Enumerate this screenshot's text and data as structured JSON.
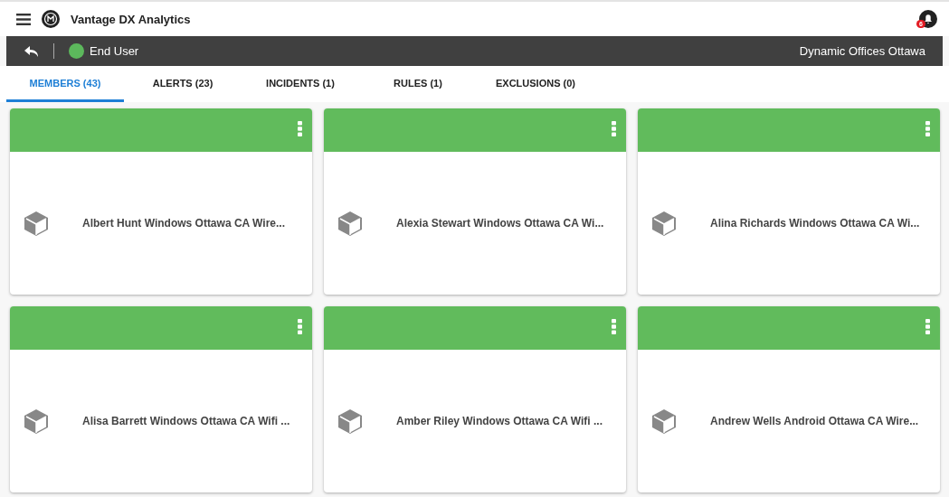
{
  "app": {
    "title": "Vantage DX Analytics",
    "notification_count": "6"
  },
  "context_bar": {
    "role": {
      "label": "End User",
      "color": "#5cb85c"
    },
    "location": "Dynamic Offices Ottawa"
  },
  "tabs": [
    {
      "label": "MEMBERS (43)",
      "selected": true
    },
    {
      "label": "ALERTS (23)",
      "selected": false
    },
    {
      "label": "INCIDENTS (1)",
      "selected": false
    },
    {
      "label": "RULES (1)",
      "selected": false
    },
    {
      "label": "EXCLUSIONS (0)",
      "selected": false
    }
  ],
  "members": [
    {
      "name": "Albert Hunt Windows Ottawa CA Wire...",
      "color": "#61bb5c"
    },
    {
      "name": "Alexia Stewart Windows Ottawa CA Wi...",
      "color": "#61bb5c"
    },
    {
      "name": "Alina Richards Windows Ottawa CA Wi...",
      "color": "#61bb5c"
    },
    {
      "name": "Alisa Barrett Windows Ottawa CA Wifi ...",
      "color": "#61bb5c"
    },
    {
      "name": "Amber Riley Windows Ottawa CA Wifi ...",
      "color": "#61bb5c"
    },
    {
      "name": "Andrew Wells Android Ottawa CA Wire...",
      "color": "#61bb5c"
    }
  ]
}
